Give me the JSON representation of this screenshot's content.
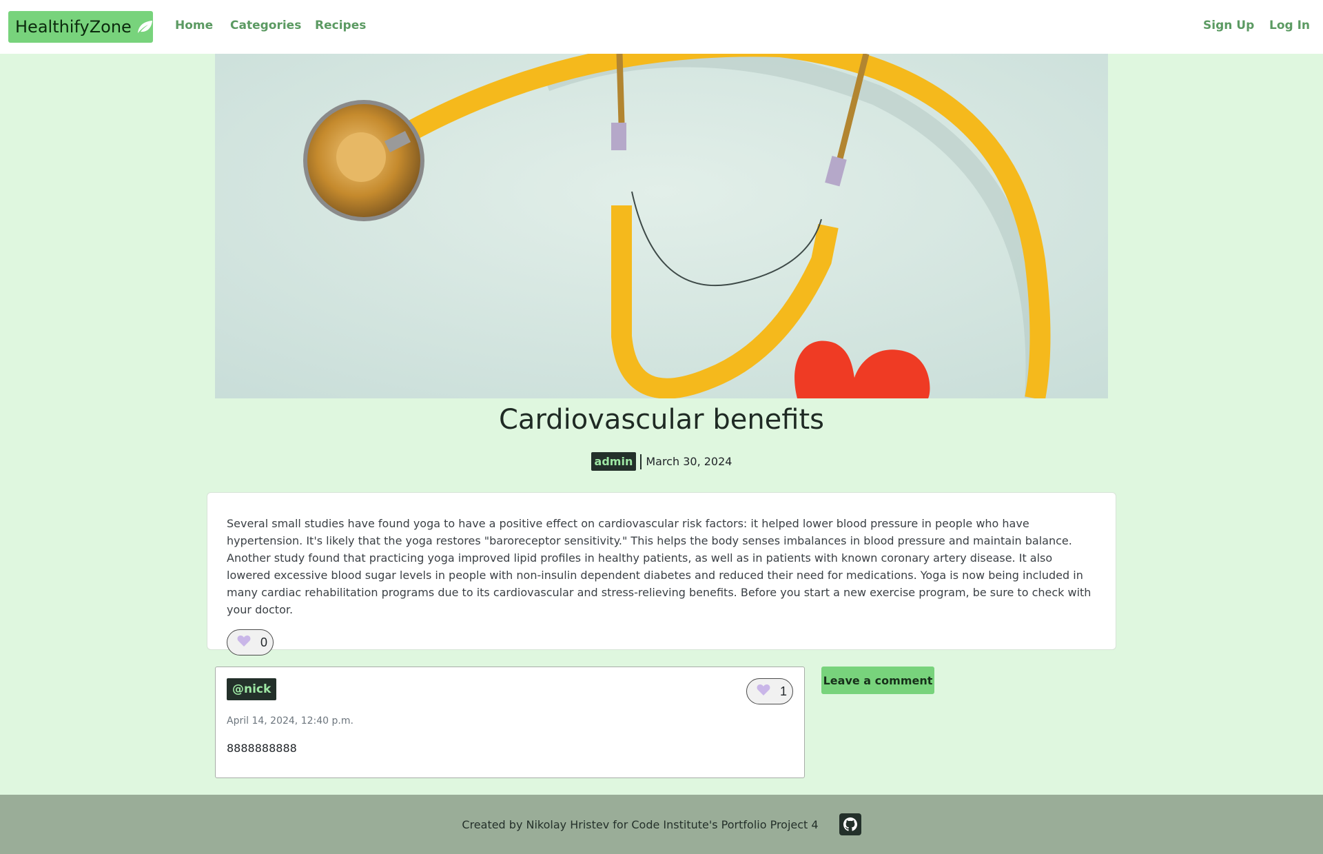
{
  "navbar": {
    "brand": "HealthifyZone",
    "brand_icon": "leaf-icon",
    "links": [
      "Home",
      "Categories",
      "Recipes"
    ],
    "auth_links": [
      "Sign Up",
      "Log In"
    ],
    "accent_color": "#78d37c",
    "link_color": "#5b9a62"
  },
  "hero": {
    "alt": "stethoscope with paper heart"
  },
  "post": {
    "title": "Cardiovascular benefits",
    "author": "admin",
    "date": "March 30, 2024",
    "content": "Several small studies have found yoga to have a positive effect on cardiovascular risk factors: it helped lower blood pressure in people who have hypertension. It's likely that the yoga restores \"baroreceptor sensitivity.\" This helps the body senses imbalances in blood pressure and maintain balance. Another study found that practicing yoga improved lipid profiles in healthy patients, as well as in patients with known coronary artery disease. It also lowered excessive blood sugar levels in people with non-insulin dependent diabetes and reduced their need for medications. Yoga is now being included in many cardiac rehabilitation programs due to its cardiovascular and stress-relieving benefits. Before you start a new exercise program, be sure to check with your doctor.",
    "likes": "0",
    "like_icon": "heart-icon"
  },
  "comments": [
    {
      "author": "@nick",
      "date": "April 14, 2024, 12:40 p.m.",
      "body": "8888888888",
      "likes": "1"
    }
  ],
  "leave_comment_label": "Leave a comment",
  "footer": {
    "text": "Created by Nikolay Hristev for Code Institute's Portfolio Project 4",
    "icon": "github-icon"
  },
  "colors": {
    "page_bg": "#dff7df",
    "footer_bg": "#9aad98",
    "badge_bg": "#23302a",
    "badge_text": "#9ee7a4",
    "heart": "#c9b6e8"
  }
}
